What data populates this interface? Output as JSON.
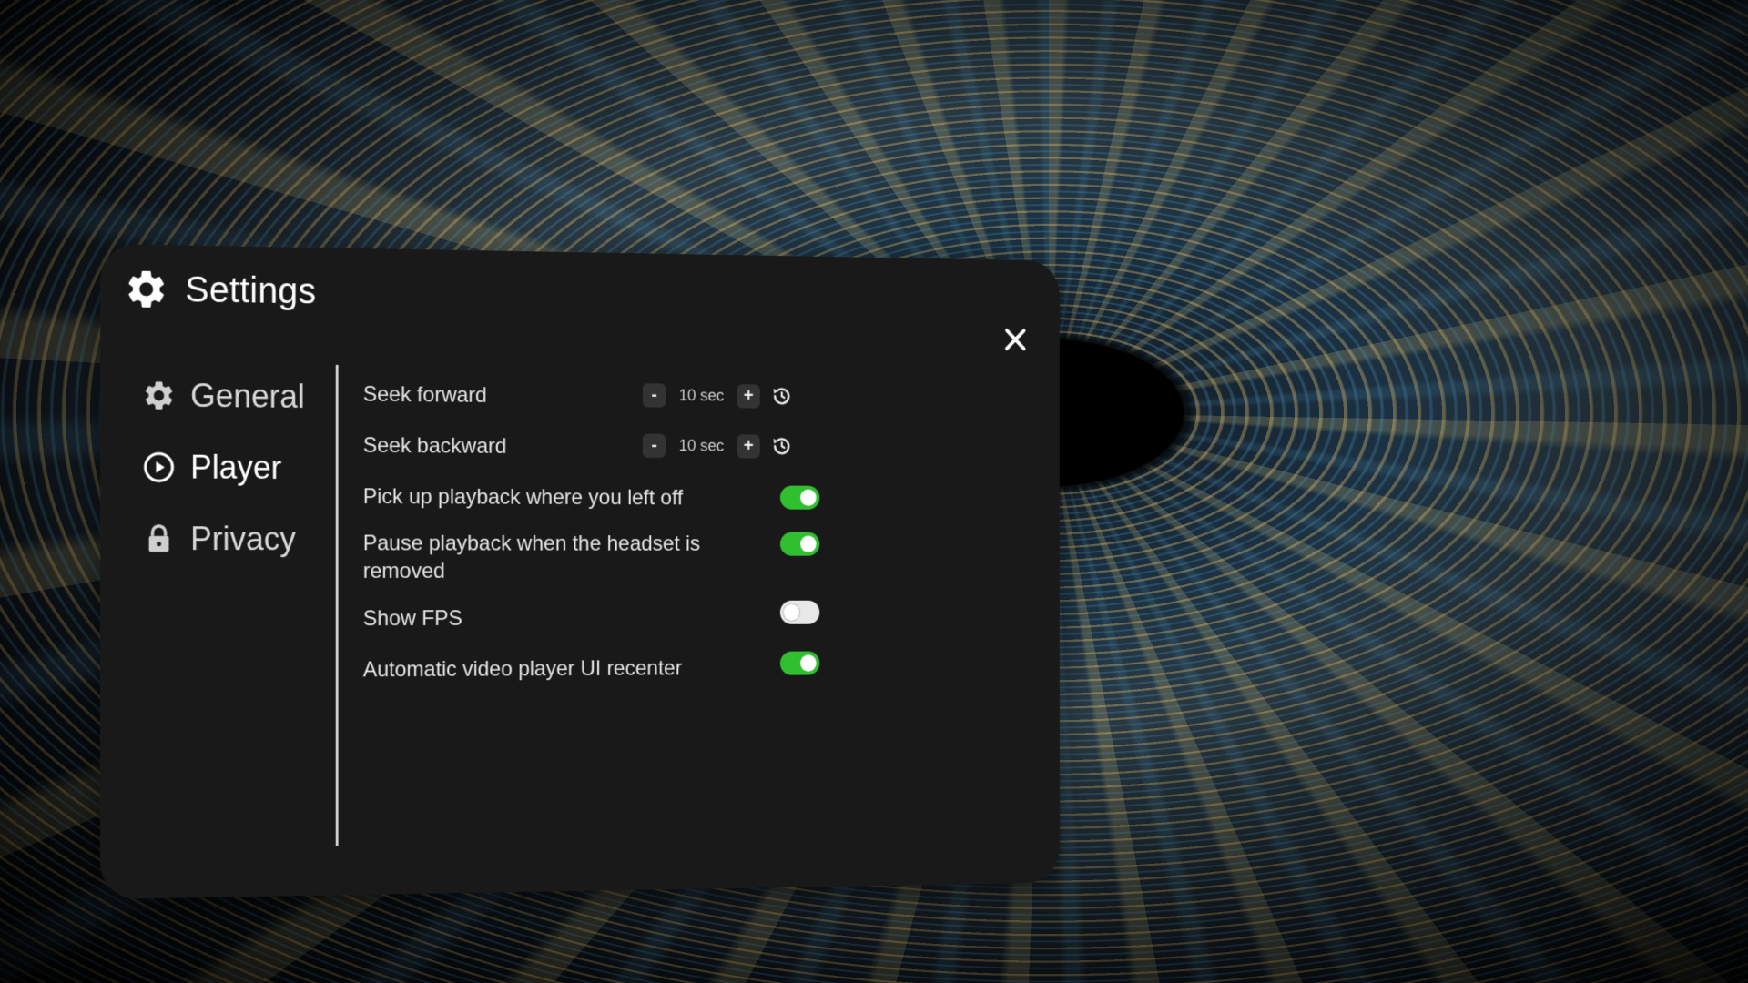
{
  "header": {
    "title": "Settings"
  },
  "sidebar": {
    "items": [
      {
        "label": "General",
        "icon": "gear-icon",
        "active": false
      },
      {
        "label": "Player",
        "icon": "play-circle-icon",
        "active": true
      },
      {
        "label": "Privacy",
        "icon": "lock-icon",
        "active": false
      }
    ]
  },
  "player_settings": {
    "seek_forward": {
      "label": "Seek forward",
      "value": "10 sec",
      "decrement": "-",
      "increment": "+"
    },
    "seek_backward": {
      "label": "Seek backward",
      "value": "10 sec",
      "decrement": "-",
      "increment": "+"
    },
    "toggles": [
      {
        "label": "Pick up playback where you left off",
        "on": true
      },
      {
        "label": "Pause playback when the headset is removed",
        "on": true
      },
      {
        "label": "Show FPS",
        "on": false
      },
      {
        "label": "Automatic video player UI recenter",
        "on": true
      }
    ]
  },
  "colors": {
    "panel": "#191919",
    "toggle_on": "#2fbf2f",
    "toggle_off": "#e8e8e8"
  }
}
